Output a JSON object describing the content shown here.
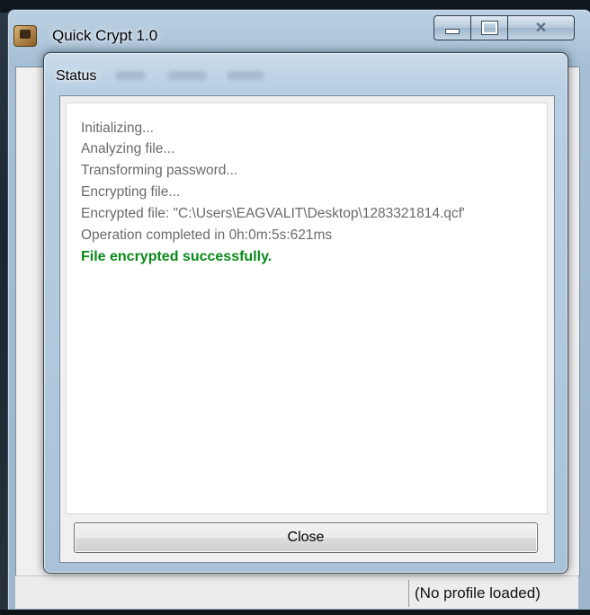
{
  "main_window": {
    "title": "Quick Crypt 1.0",
    "icon": "app-icon",
    "caption_buttons": [
      "minimize",
      "maximize",
      "close"
    ]
  },
  "status_bar": {
    "text": "(No profile loaded)"
  },
  "dialog": {
    "title": "Status",
    "lines": [
      "Initializing...",
      "Analyzing file...",
      "Transforming password...",
      "Encrypting file...",
      "Encrypted file: \"C:\\Users\\EAGVALIT\\Desktop\\1283321814.qcf'",
      "Operation completed in 0h:0m:5s:621ms"
    ],
    "result": "File encrypted successfully.",
    "close_label": "Close"
  },
  "colors": {
    "success": "#0a8a1a",
    "log_text": "#6a6a6a"
  }
}
